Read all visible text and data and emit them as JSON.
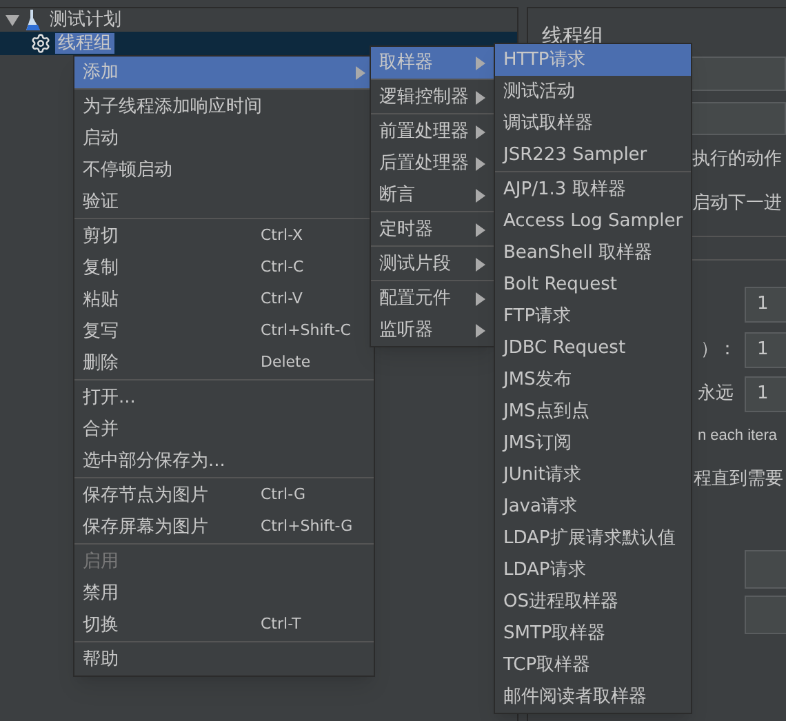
{
  "tree": {
    "root": {
      "label": "测试计划",
      "expanded": true,
      "selected": false,
      "children": [
        {
          "label": "线程组",
          "selected": true
        }
      ]
    }
  },
  "panel": {
    "title": "线程组",
    "action_label": "执行的动作",
    "next_loop_label": "启动下一进",
    "threads_value": "1",
    "rampup_label": "）：",
    "rampup_value": "1",
    "loop_label": "永远",
    "loop_value": "1",
    "same_user_label": "n each itera",
    "delay_label": "程直到需要"
  },
  "context_menu": {
    "groups": [
      [
        {
          "label": "添加",
          "submenu": true,
          "selected": true,
          "disabled": false
        }
      ],
      [
        {
          "label": "为子线程添加响应时间",
          "submenu": false,
          "selected": false,
          "disabled": false
        },
        {
          "label": "启动",
          "submenu": false,
          "selected": false,
          "disabled": false
        },
        {
          "label": "不停顿启动",
          "submenu": false,
          "selected": false,
          "disabled": false
        },
        {
          "label": "验证",
          "submenu": false,
          "selected": false,
          "disabled": false
        }
      ],
      [
        {
          "label": "剪切",
          "shortcut": "Ctrl-X",
          "submenu": false,
          "selected": false,
          "disabled": false
        },
        {
          "label": "复制",
          "shortcut": "Ctrl-C",
          "submenu": false,
          "selected": false,
          "disabled": false
        },
        {
          "label": "粘贴",
          "shortcut": "Ctrl-V",
          "submenu": false,
          "selected": false,
          "disabled": false
        },
        {
          "label": "复写",
          "shortcut": "Ctrl+Shift-C",
          "submenu": false,
          "selected": false,
          "disabled": false
        },
        {
          "label": "删除",
          "shortcut": "Delete",
          "submenu": false,
          "selected": false,
          "disabled": false
        }
      ],
      [
        {
          "label": "打开...",
          "submenu": false,
          "selected": false,
          "disabled": false
        },
        {
          "label": "合并",
          "submenu": false,
          "selected": false,
          "disabled": false
        },
        {
          "label": "选中部分保存为...",
          "submenu": false,
          "selected": false,
          "disabled": false
        }
      ],
      [
        {
          "label": "保存节点为图片",
          "shortcut": "Ctrl-G",
          "submenu": false,
          "selected": false,
          "disabled": false
        },
        {
          "label": "保存屏幕为图片",
          "shortcut": "Ctrl+Shift-G",
          "submenu": false,
          "selected": false,
          "disabled": false
        }
      ],
      [
        {
          "label": "启用",
          "submenu": false,
          "selected": false,
          "disabled": true
        },
        {
          "label": "禁用",
          "submenu": false,
          "selected": false,
          "disabled": false
        },
        {
          "label": "切换",
          "shortcut": "Ctrl-T",
          "submenu": false,
          "selected": false,
          "disabled": false
        }
      ],
      [
        {
          "label": "帮助",
          "submenu": false,
          "selected": false,
          "disabled": false
        }
      ]
    ]
  },
  "add_submenu": {
    "groups": [
      [
        {
          "label": "取样器",
          "submenu": true,
          "selected": true
        }
      ],
      [
        {
          "label": "逻辑控制器",
          "submenu": true,
          "selected": false
        }
      ],
      [
        {
          "label": "前置处理器",
          "submenu": true,
          "selected": false
        },
        {
          "label": "后置处理器",
          "submenu": true,
          "selected": false
        },
        {
          "label": "断言",
          "submenu": true,
          "selected": false
        }
      ],
      [
        {
          "label": "定时器",
          "submenu": true,
          "selected": false
        }
      ],
      [
        {
          "label": "测试片段",
          "submenu": true,
          "selected": false
        }
      ],
      [
        {
          "label": "配置元件",
          "submenu": true,
          "selected": false
        },
        {
          "label": "监听器",
          "submenu": true,
          "selected": false
        }
      ]
    ]
  },
  "sampler_submenu": {
    "groups": [
      [
        {
          "label": "HTTP请求",
          "submenu": false,
          "selected": true
        },
        {
          "label": "测试活动",
          "submenu": false,
          "selected": false
        },
        {
          "label": "调试取样器",
          "submenu": false,
          "selected": false
        },
        {
          "label": "JSR223 Sampler",
          "submenu": false,
          "selected": false
        }
      ],
      [
        {
          "label": "AJP/1.3 取样器",
          "submenu": false,
          "selected": false
        },
        {
          "label": "Access Log Sampler",
          "submenu": false,
          "selected": false
        },
        {
          "label": "BeanShell 取样器",
          "submenu": false,
          "selected": false
        },
        {
          "label": "Bolt Request",
          "submenu": false,
          "selected": false
        },
        {
          "label": "FTP请求",
          "submenu": false,
          "selected": false
        },
        {
          "label": "JDBC Request",
          "submenu": false,
          "selected": false
        },
        {
          "label": "JMS发布",
          "submenu": false,
          "selected": false
        },
        {
          "label": "JMS点到点",
          "submenu": false,
          "selected": false
        },
        {
          "label": "JMS订阅",
          "submenu": false,
          "selected": false
        },
        {
          "label": "JUnit请求",
          "submenu": false,
          "selected": false
        },
        {
          "label": "Java请求",
          "submenu": false,
          "selected": false
        },
        {
          "label": "LDAP扩展请求默认值",
          "submenu": false,
          "selected": false
        },
        {
          "label": "LDAP请求",
          "submenu": false,
          "selected": false
        },
        {
          "label": "OS进程取样器",
          "submenu": false,
          "selected": false
        },
        {
          "label": "SMTP取样器",
          "submenu": false,
          "selected": false
        },
        {
          "label": "TCP取样器",
          "submenu": false,
          "selected": false
        },
        {
          "label": "邮件阅读者取样器",
          "submenu": false,
          "selected": false
        }
      ]
    ]
  }
}
